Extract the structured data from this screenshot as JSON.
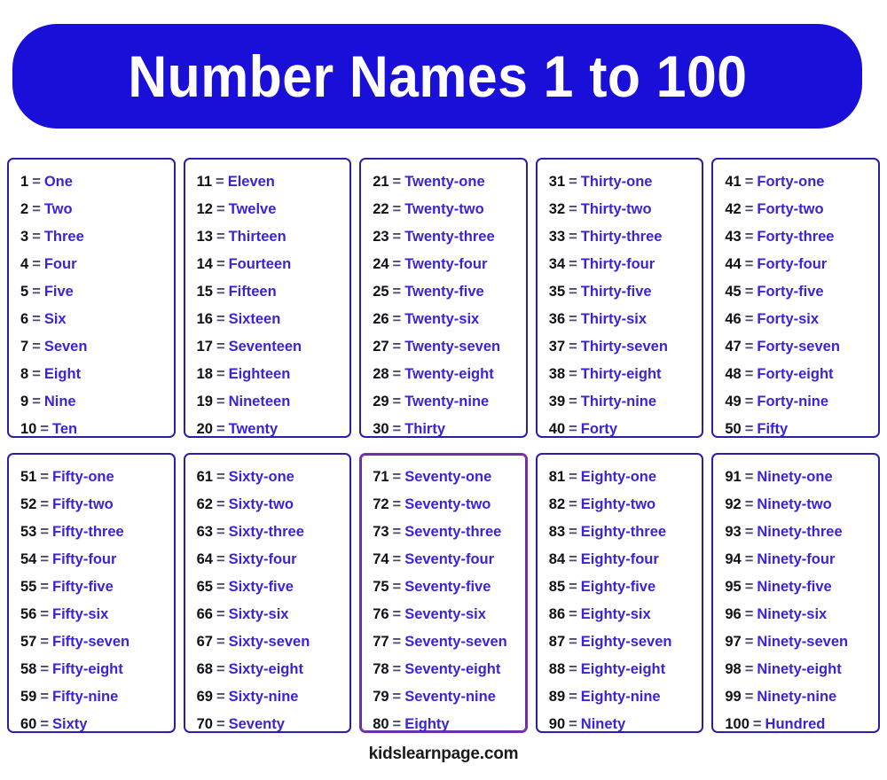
{
  "banner": {
    "title": "Number Names 1 to 100",
    "background_color": "#1a0fd8",
    "text_color": "#ffffff"
  },
  "colors": {
    "number": "#111118",
    "equals": "#4a4a6a",
    "word": "#3a24d6",
    "card_border": "#2a1fa8",
    "card_border_accent": "#7b2f9e",
    "page_background": "#ffffff"
  },
  "separator": "=",
  "cards": [
    {
      "id": "card-1-10",
      "range_start": 1,
      "range_end": 10,
      "border_accent": false,
      "rows": [
        {
          "number": "1",
          "name": "One"
        },
        {
          "number": "2",
          "name": "Two"
        },
        {
          "number": "3",
          "name": "Three"
        },
        {
          "number": "4",
          "name": "Four"
        },
        {
          "number": "5",
          "name": "Five"
        },
        {
          "number": "6",
          "name": "Six"
        },
        {
          "number": "7",
          "name": "Seven"
        },
        {
          "number": "8",
          "name": "Eight"
        },
        {
          "number": "9",
          "name": "Nine"
        },
        {
          "number": "10",
          "name": "Ten"
        }
      ]
    },
    {
      "id": "card-11-20",
      "range_start": 11,
      "range_end": 20,
      "border_accent": false,
      "rows": [
        {
          "number": "11",
          "name": "Eleven"
        },
        {
          "number": "12",
          "name": "Twelve"
        },
        {
          "number": "13",
          "name": "Thirteen"
        },
        {
          "number": "14",
          "name": "Fourteen"
        },
        {
          "number": "15",
          "name": "Fifteen"
        },
        {
          "number": "16",
          "name": "Sixteen"
        },
        {
          "number": "17",
          "name": "Seventeen"
        },
        {
          "number": "18",
          "name": "Eighteen"
        },
        {
          "number": "19",
          "name": "Nineteen"
        },
        {
          "number": "20",
          "name": "Twenty"
        }
      ]
    },
    {
      "id": "card-21-30",
      "range_start": 21,
      "range_end": 30,
      "border_accent": false,
      "rows": [
        {
          "number": "21",
          "name": "Twenty-one"
        },
        {
          "number": "22",
          "name": "Twenty-two"
        },
        {
          "number": "23",
          "name": "Twenty-three"
        },
        {
          "number": "24",
          "name": "Twenty-four"
        },
        {
          "number": "25",
          "name": "Twenty-five"
        },
        {
          "number": "26",
          "name": "Twenty-six"
        },
        {
          "number": "27",
          "name": "Twenty-seven"
        },
        {
          "number": "28",
          "name": "Twenty-eight"
        },
        {
          "number": "29",
          "name": "Twenty-nine"
        },
        {
          "number": "30",
          "name": "Thirty"
        }
      ]
    },
    {
      "id": "card-31-40",
      "range_start": 31,
      "range_end": 40,
      "border_accent": false,
      "rows": [
        {
          "number": "31",
          "name": "Thirty-one"
        },
        {
          "number": "32",
          "name": "Thirty-two"
        },
        {
          "number": "33",
          "name": "Thirty-three"
        },
        {
          "number": "34",
          "name": "Thirty-four"
        },
        {
          "number": "35",
          "name": "Thirty-five"
        },
        {
          "number": "36",
          "name": "Thirty-six"
        },
        {
          "number": "37",
          "name": "Thirty-seven"
        },
        {
          "number": "38",
          "name": "Thirty-eight"
        },
        {
          "number": "39",
          "name": "Thirty-nine"
        },
        {
          "number": "40",
          "name": "Forty"
        }
      ]
    },
    {
      "id": "card-41-50",
      "range_start": 41,
      "range_end": 50,
      "border_accent": false,
      "rows": [
        {
          "number": "41",
          "name": "Forty-one"
        },
        {
          "number": "42",
          "name": "Forty-two"
        },
        {
          "number": "43",
          "name": "Forty-three"
        },
        {
          "number": "44",
          "name": "Forty-four"
        },
        {
          "number": "45",
          "name": "Forty-five"
        },
        {
          "number": "46",
          "name": "Forty-six"
        },
        {
          "number": "47",
          "name": "Forty-seven"
        },
        {
          "number": "48",
          "name": "Forty-eight"
        },
        {
          "number": "49",
          "name": "Forty-nine"
        },
        {
          "number": "50",
          "name": "Fifty"
        }
      ]
    },
    {
      "id": "card-51-60",
      "range_start": 51,
      "range_end": 60,
      "border_accent": false,
      "rows": [
        {
          "number": "51",
          "name": "Fifty-one"
        },
        {
          "number": "52",
          "name": "Fifty-two"
        },
        {
          "number": "53",
          "name": "Fifty-three"
        },
        {
          "number": "54",
          "name": "Fifty-four"
        },
        {
          "number": "55",
          "name": "Fifty-five"
        },
        {
          "number": "56",
          "name": "Fifty-six"
        },
        {
          "number": "57",
          "name": "Fifty-seven"
        },
        {
          "number": "58",
          "name": "Fifty-eight"
        },
        {
          "number": "59",
          "name": "Fifty-nine"
        },
        {
          "number": "60",
          "name": "Sixty"
        }
      ]
    },
    {
      "id": "card-61-70",
      "range_start": 61,
      "range_end": 70,
      "border_accent": false,
      "rows": [
        {
          "number": "61",
          "name": "Sixty-one"
        },
        {
          "number": "62",
          "name": "Sixty-two"
        },
        {
          "number": "63",
          "name": "Sixty-three"
        },
        {
          "number": "64",
          "name": "Sixty-four"
        },
        {
          "number": "65",
          "name": "Sixty-five"
        },
        {
          "number": "66",
          "name": "Sixty-six"
        },
        {
          "number": "67",
          "name": "Sixty-seven"
        },
        {
          "number": "68",
          "name": "Sixty-eight"
        },
        {
          "number": "69",
          "name": "Sixty-nine"
        },
        {
          "number": "70",
          "name": "Seventy"
        }
      ]
    },
    {
      "id": "card-71-80",
      "range_start": 71,
      "range_end": 80,
      "border_accent": true,
      "rows": [
        {
          "number": "71",
          "name": "Seventy-one"
        },
        {
          "number": "72",
          "name": "Seventy-two"
        },
        {
          "number": "73",
          "name": "Seventy-three"
        },
        {
          "number": "74",
          "name": "Seventy-four"
        },
        {
          "number": "75",
          "name": "Seventy-five"
        },
        {
          "number": "76",
          "name": "Seventy-six"
        },
        {
          "number": "77",
          "name": "Seventy-seven"
        },
        {
          "number": "78",
          "name": "Seventy-eight"
        },
        {
          "number": "79",
          "name": "Seventy-nine"
        },
        {
          "number": "80",
          "name": "Eighty"
        }
      ]
    },
    {
      "id": "card-81-90",
      "range_start": 81,
      "range_end": 90,
      "border_accent": false,
      "rows": [
        {
          "number": "81",
          "name": "Eighty-one"
        },
        {
          "number": "82",
          "name": "Eighty-two"
        },
        {
          "number": "83",
          "name": "Eighty-three"
        },
        {
          "number": "84",
          "name": "Eighty-four"
        },
        {
          "number": "85",
          "name": "Eighty-five"
        },
        {
          "number": "86",
          "name": "Eighty-six"
        },
        {
          "number": "87",
          "name": "Eighty-seven"
        },
        {
          "number": "88",
          "name": "Eighty-eight"
        },
        {
          "number": "89",
          "name": "Eighty-nine"
        },
        {
          "number": "90",
          "name": "Ninety"
        }
      ]
    },
    {
      "id": "card-91-100",
      "range_start": 91,
      "range_end": 100,
      "border_accent": false,
      "rows": [
        {
          "number": "91",
          "name": "Ninety-one"
        },
        {
          "number": "92",
          "name": "Ninety-two"
        },
        {
          "number": "93",
          "name": "Ninety-three"
        },
        {
          "number": "94",
          "name": "Ninety-four"
        },
        {
          "number": "95",
          "name": "Ninety-five"
        },
        {
          "number": "96",
          "name": "Ninety-six"
        },
        {
          "number": "97",
          "name": "Ninety-seven"
        },
        {
          "number": "98",
          "name": "Ninety-eight"
        },
        {
          "number": "99",
          "name": "Ninety-nine"
        },
        {
          "number": "100",
          "name": "Hundred"
        }
      ]
    }
  ],
  "footer": {
    "text": "kidslearnpage.com"
  }
}
